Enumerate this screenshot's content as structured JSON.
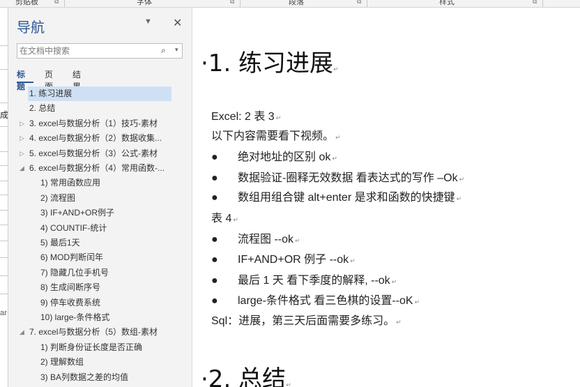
{
  "ribbon": {
    "groups": [
      "剪贴板",
      "字体",
      "段落",
      "样式"
    ]
  },
  "left_strip": {
    "fragments": [
      "成",
      "ar"
    ]
  },
  "nav_pane": {
    "title": "导航",
    "search_placeholder": "在文档中搜索",
    "tabs": [
      "标题",
      "页面",
      "结果"
    ],
    "active_tab": "标题",
    "headings": [
      {
        "label": "1. 练习进展",
        "level": 1,
        "expander": "none",
        "selected": true
      },
      {
        "label": "2. 总结",
        "level": 1,
        "expander": "none"
      },
      {
        "label": "3. excel与数据分析（1）技巧-素材",
        "level": 1,
        "expander": "collapsed"
      },
      {
        "label": "4. excel与数据分析（2）数据收集...",
        "level": 1,
        "expander": "collapsed"
      },
      {
        "label": "5. excel与数据分析（3）公式-素材",
        "level": 1,
        "expander": "collapsed"
      },
      {
        "label": "6. excel与数据分析（4）常用函数-...",
        "level": 1,
        "expander": "expanded"
      },
      {
        "label": "1) 常用函数应用",
        "level": 2
      },
      {
        "label": "2) 流程图",
        "level": 2
      },
      {
        "label": "3) IF+AND+OR例子",
        "level": 2
      },
      {
        "label": "4) COUNTIF-统计",
        "level": 2
      },
      {
        "label": "5) 最后1天",
        "level": 2
      },
      {
        "label": "6) MOD判断闰年",
        "level": 2
      },
      {
        "label": "7) 隐藏几位手机号",
        "level": 2
      },
      {
        "label": "8) 生成间断序号",
        "level": 2
      },
      {
        "label": "9) 停车收费系统",
        "level": 2
      },
      {
        "label": "10) large-条件格式",
        "level": 2
      },
      {
        "label": "7. excel与数据分析（5）数组-素材",
        "level": 1,
        "expander": "expanded"
      },
      {
        "label": "1) 判断身份证长度是否正确",
        "level": 2
      },
      {
        "label": "2) 理解数组",
        "level": 2
      },
      {
        "label": "3) BA列数据之差的均值",
        "level": 2
      }
    ]
  },
  "document": {
    "heading1": "·1. 练习进展",
    "lines": [
      {
        "text": "Excel: 2  表 3",
        "bullet": false
      },
      {
        "text": "以下内容需要看下视频。",
        "bullet": false
      },
      {
        "text": "绝对地址的区别  ok",
        "bullet": true
      },
      {
        "text": "数据验证-圈释无效数据  看表达式的写作  –Ok",
        "bullet": true
      },
      {
        "text": "数组用组合键  alt+enter 是求和函数的快捷键",
        "bullet": true
      },
      {
        "text": "表 4",
        "bullet": false
      },
      {
        "text": "流程图  --ok",
        "bullet": true
      },
      {
        "text": "IF+AND+OR 例子  --ok",
        "bullet": true
      },
      {
        "text": "最后 1 天    看下季度的解释, --ok",
        "bullet": true
      },
      {
        "text": "large-条件格式  看三色棋的设置--oK",
        "bullet": true
      },
      {
        "text": "Sql：进展，第三天后面需要多练习。",
        "bullet": false
      }
    ],
    "heading2": "·2. 总结",
    "bullet_char": "●",
    "paragraph_mark": "↵"
  },
  "colors": {
    "accent": "#2b5797",
    "selected_bg": "#cfe0f5",
    "nav_bg": "#f3f3f3"
  }
}
